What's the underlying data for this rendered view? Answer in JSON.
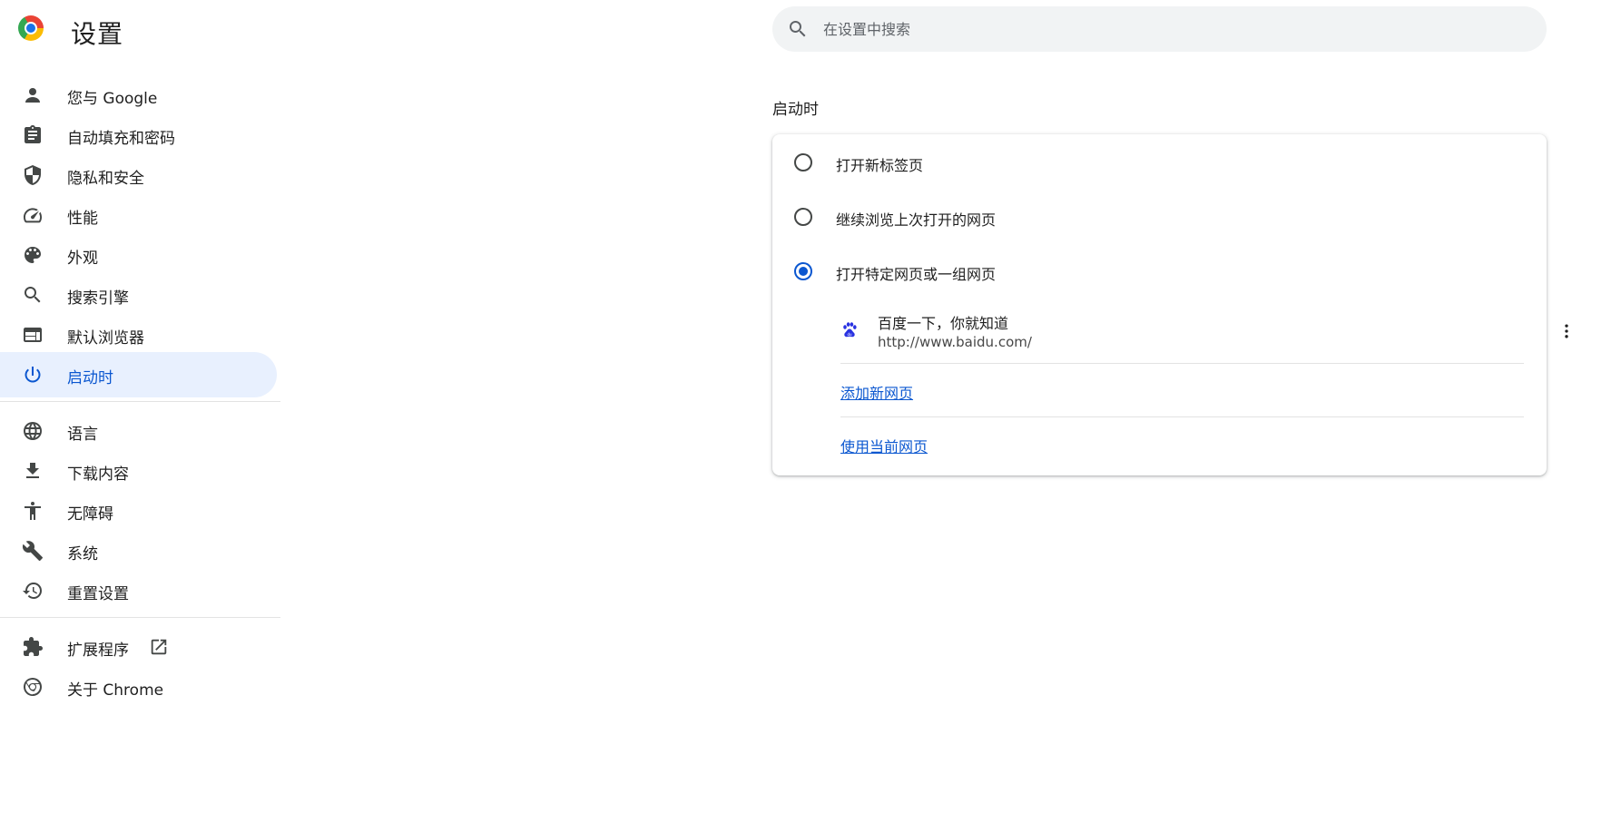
{
  "header": {
    "title": "设置",
    "logo_icon": "chrome-logo-icon"
  },
  "search": {
    "placeholder": "在设置中搜索",
    "value": ""
  },
  "sidebar": {
    "items": [
      {
        "label": "您与 Google",
        "icon": "person-icon"
      },
      {
        "label": "自动填充和密码",
        "icon": "clipboard-icon"
      },
      {
        "label": "隐私和安全",
        "icon": "shield-icon"
      },
      {
        "label": "性能",
        "icon": "speedometer-icon"
      },
      {
        "label": "外观",
        "icon": "palette-icon"
      },
      {
        "label": "搜索引擎",
        "icon": "search-icon"
      },
      {
        "label": "默认浏览器",
        "icon": "browser-window-icon"
      },
      {
        "label": "启动时",
        "icon": "power-icon",
        "active": true
      },
      {
        "label": "语言",
        "icon": "globe-icon"
      },
      {
        "label": "下载内容",
        "icon": "download-icon"
      },
      {
        "label": "无障碍",
        "icon": "accessibility-icon"
      },
      {
        "label": "系统",
        "icon": "wrench-icon"
      },
      {
        "label": "重置设置",
        "icon": "restore-icon"
      },
      {
        "label": "扩展程序",
        "icon": "puzzle-icon",
        "external": true
      },
      {
        "label": "关于 Chrome",
        "icon": "chrome-icon"
      }
    ]
  },
  "main": {
    "section_title": "启动时",
    "options": [
      {
        "label": "打开新标签页",
        "checked": false
      },
      {
        "label": "继续浏览上次打开的网页",
        "checked": false
      },
      {
        "label": "打开特定网页或一组网页",
        "checked": true
      }
    ],
    "pages": [
      {
        "name": "百度一下，你就知道",
        "url": "http://www.baidu.com/",
        "favicon": "baidu-paw-icon"
      }
    ],
    "add_page_link": "添加新网页",
    "use_current_link": "使用当前网页"
  },
  "colors": {
    "accent": "#0b57d0",
    "active_bg": "#e8f0fe",
    "search_bg": "#f1f3f4"
  }
}
